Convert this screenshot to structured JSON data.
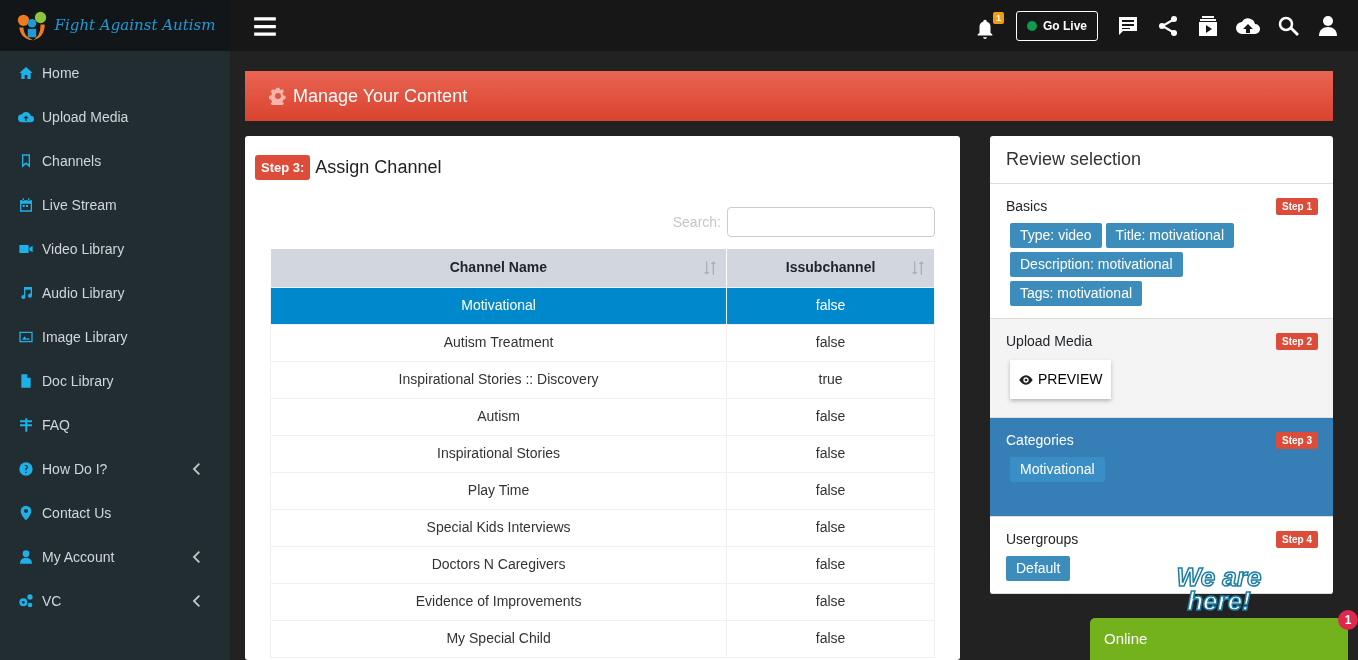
{
  "brand": {
    "name": "Fight Against Autism"
  },
  "topbar": {
    "notification_count": "1",
    "go_live": "Go Live"
  },
  "sidebar": {
    "items": [
      {
        "label": "Home",
        "expandable": false
      },
      {
        "label": "Upload Media",
        "expandable": false
      },
      {
        "label": "Channels",
        "expandable": false
      },
      {
        "label": "Live Stream",
        "expandable": false
      },
      {
        "label": "Video Library",
        "expandable": false
      },
      {
        "label": "Audio Library",
        "expandable": false
      },
      {
        "label": "Image Library",
        "expandable": false
      },
      {
        "label": "Doc Library",
        "expandable": false
      },
      {
        "label": "FAQ",
        "expandable": false
      },
      {
        "label": "How Do I?",
        "expandable": true
      },
      {
        "label": "Contact Us",
        "expandable": false
      },
      {
        "label": "My Account",
        "expandable": true
      },
      {
        "label": "VC",
        "expandable": true
      }
    ]
  },
  "banner": {
    "title": "Manage Your Content"
  },
  "assign": {
    "step": "Step 3:",
    "title": "Assign Channel",
    "search_label": "Search:",
    "table": {
      "columns": [
        "Channel Name",
        "Issubchannel"
      ],
      "rows": [
        {
          "cells": [
            "Motivational",
            "false"
          ],
          "selected": true
        },
        {
          "cells": [
            "Autism Treatment",
            "false"
          ],
          "selected": false
        },
        {
          "cells": [
            "Inspirational Stories :: Discovery",
            "true"
          ],
          "selected": false
        },
        {
          "cells": [
            "Autism",
            "false"
          ],
          "selected": false
        },
        {
          "cells": [
            "Inspirational Stories",
            "false"
          ],
          "selected": false
        },
        {
          "cells": [
            "Play Time",
            "false"
          ],
          "selected": false
        },
        {
          "cells": [
            "Special Kids Interviews",
            "false"
          ],
          "selected": false
        },
        {
          "cells": [
            "Doctors N Caregivers",
            "false"
          ],
          "selected": false
        },
        {
          "cells": [
            "Evidence of Improvements",
            "false"
          ],
          "selected": false
        },
        {
          "cells": [
            "My Special Child",
            "false"
          ],
          "selected": false
        }
      ]
    }
  },
  "review": {
    "title": "Review selection",
    "sections": [
      {
        "kind": "tags",
        "title": "Basics",
        "step": "Step 1",
        "selected": false,
        "tags": [
          "Type: video",
          "Title: motivational",
          "Description: motivational",
          "Tags: motivational"
        ]
      },
      {
        "kind": "media",
        "title": "Upload Media",
        "step": "Step 2",
        "selected": false,
        "button": "PREVIEW"
      },
      {
        "kind": "tags",
        "title": "Categories",
        "step": "Step 3",
        "selected": true,
        "tags": [
          "Motivational"
        ]
      },
      {
        "kind": "tags",
        "title": "Usergroups",
        "step": "Step 4",
        "selected": false,
        "tags": [
          "Default"
        ]
      }
    ]
  },
  "chat": {
    "logo": "We are here!",
    "status": "Online",
    "unread": "1"
  }
}
